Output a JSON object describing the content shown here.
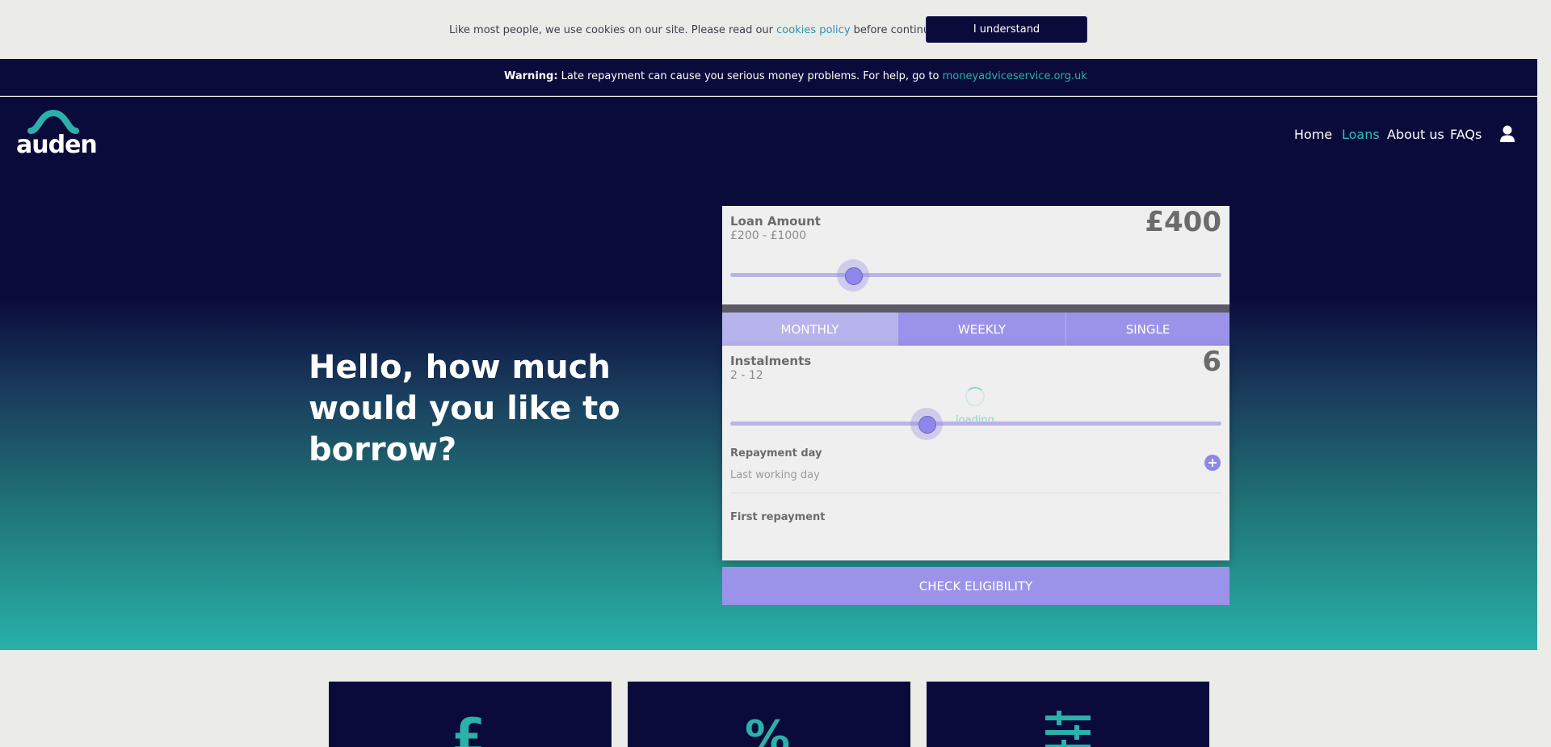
{
  "cookie_bar": {
    "text_before": "Like most people, we use cookies on our site. Please read our ",
    "link": "cookies policy",
    "text_after": " before continuing.",
    "button": "I understand"
  },
  "warning_bar": {
    "label": "Warning:",
    "text": " Late repayment can cause you serious money problems. For help, go to ",
    "link": "moneyadviceservice.org.uk"
  },
  "header": {
    "logo": "auden",
    "nav": [
      "Home",
      "Loans",
      "About us",
      "FAQs"
    ],
    "active_nav": "Loans",
    "user_icon": "user-icon"
  },
  "hero": {
    "headline": "Hello, how much would you like to borrow?"
  },
  "calculator": {
    "amount": {
      "label": "Loan Amount",
      "range": "£200 - £1000",
      "value": "£400",
      "slider_fraction": 0.25
    },
    "tabs": [
      "MONTHLY",
      "WEEKLY",
      "SINGLE"
    ],
    "active_tab": "MONTHLY",
    "instalments": {
      "label": "Instalments",
      "range": "2 - 12",
      "value": "6",
      "slider_fraction": 0.4,
      "loading": "loading"
    },
    "repayment_day": {
      "label": "Repayment day",
      "value": "Last working day"
    },
    "first_repayment": {
      "label": "First repayment"
    },
    "check_button": "CHECK ELIGIBILITY"
  },
  "feature_icons": [
    "pound-icon",
    "percent-icon",
    "sliders-icon"
  ],
  "colors": {
    "navy": "#0b0b3b",
    "teal": "#29b0a9",
    "purple": "#9b93ea"
  }
}
